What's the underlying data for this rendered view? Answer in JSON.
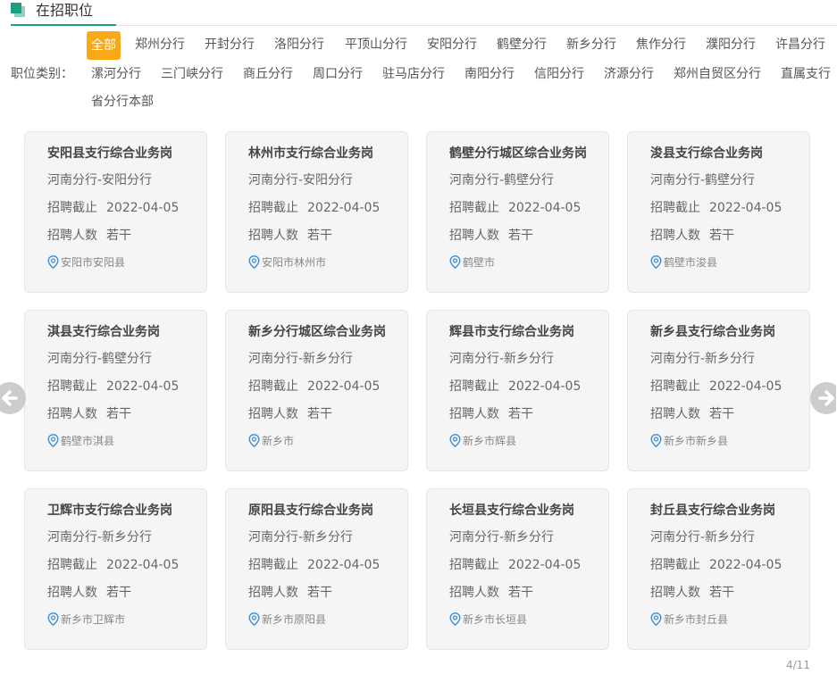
{
  "header": {
    "title": "在招职位"
  },
  "filter": {
    "label": "职位类别：",
    "options": [
      "全部",
      "郑州分行",
      "开封分行",
      "洛阳分行",
      "平顶山分行",
      "安阳分行",
      "鹤壁分行",
      "新乡分行",
      "焦作分行",
      "濮阳分行",
      "许昌分行",
      "漯河分行",
      "三门峡分行",
      "商丘分行",
      "周口分行",
      "驻马店分行",
      "南阳分行",
      "信阳分行",
      "济源分行",
      "郑州自贸区分行",
      "直属支行",
      "省分行本部"
    ],
    "active": "全部"
  },
  "labels": {
    "deadline": "招聘截止",
    "headcount": "招聘人数"
  },
  "jobs": [
    {
      "title": "安阳县支行综合业务岗",
      "branch": "河南分行-安阳分行",
      "deadline": "2022-04-05",
      "headcount": "若干",
      "location": "安阳市安阳县"
    },
    {
      "title": "林州市支行综合业务岗",
      "branch": "河南分行-安阳分行",
      "deadline": "2022-04-05",
      "headcount": "若干",
      "location": "安阳市林州市"
    },
    {
      "title": "鹤壁分行城区综合业务岗",
      "branch": "河南分行-鹤壁分行",
      "deadline": "2022-04-05",
      "headcount": "若干",
      "location": "鹤壁市"
    },
    {
      "title": "浚县支行综合业务岗",
      "branch": "河南分行-鹤壁分行",
      "deadline": "2022-04-05",
      "headcount": "若干",
      "location": "鹤壁市浚县"
    },
    {
      "title": "淇县支行综合业务岗",
      "branch": "河南分行-鹤壁分行",
      "deadline": "2022-04-05",
      "headcount": "若干",
      "location": "鹤壁市淇县"
    },
    {
      "title": "新乡分行城区综合业务岗",
      "branch": "河南分行-新乡分行",
      "deadline": "2022-04-05",
      "headcount": "若干",
      "location": "新乡市"
    },
    {
      "title": "辉县市支行综合业务岗",
      "branch": "河南分行-新乡分行",
      "deadline": "2022-04-05",
      "headcount": "若干",
      "location": "新乡市辉县"
    },
    {
      "title": "新乡县支行综合业务岗",
      "branch": "河南分行-新乡分行",
      "deadline": "2022-04-05",
      "headcount": "若干",
      "location": "新乡市新乡县"
    },
    {
      "title": "卫辉市支行综合业务岗",
      "branch": "河南分行-新乡分行",
      "deadline": "2022-04-05",
      "headcount": "若干",
      "location": "新乡市卫辉市"
    },
    {
      "title": "原阳县支行综合业务岗",
      "branch": "河南分行-新乡分行",
      "deadline": "2022-04-05",
      "headcount": "若干",
      "location": "新乡市原阳县"
    },
    {
      "title": "长垣县支行综合业务岗",
      "branch": "河南分行-新乡分行",
      "deadline": "2022-04-05",
      "headcount": "若干",
      "location": "新乡市长垣县"
    },
    {
      "title": "封丘县支行综合业务岗",
      "branch": "河南分行-新乡分行",
      "deadline": "2022-04-05",
      "headcount": "若干",
      "location": "新乡市封丘县"
    }
  ],
  "pager": {
    "text": "4/11"
  },
  "colors": {
    "accent": "#1aa07e",
    "active_tag": "#f8a917",
    "arrow": "#cccccc",
    "pin": "#3b8fd9"
  },
  "icons": {
    "header": "section-icon",
    "location": "location-pin-icon",
    "prev": "arrow-left-icon",
    "next": "arrow-right-icon"
  }
}
